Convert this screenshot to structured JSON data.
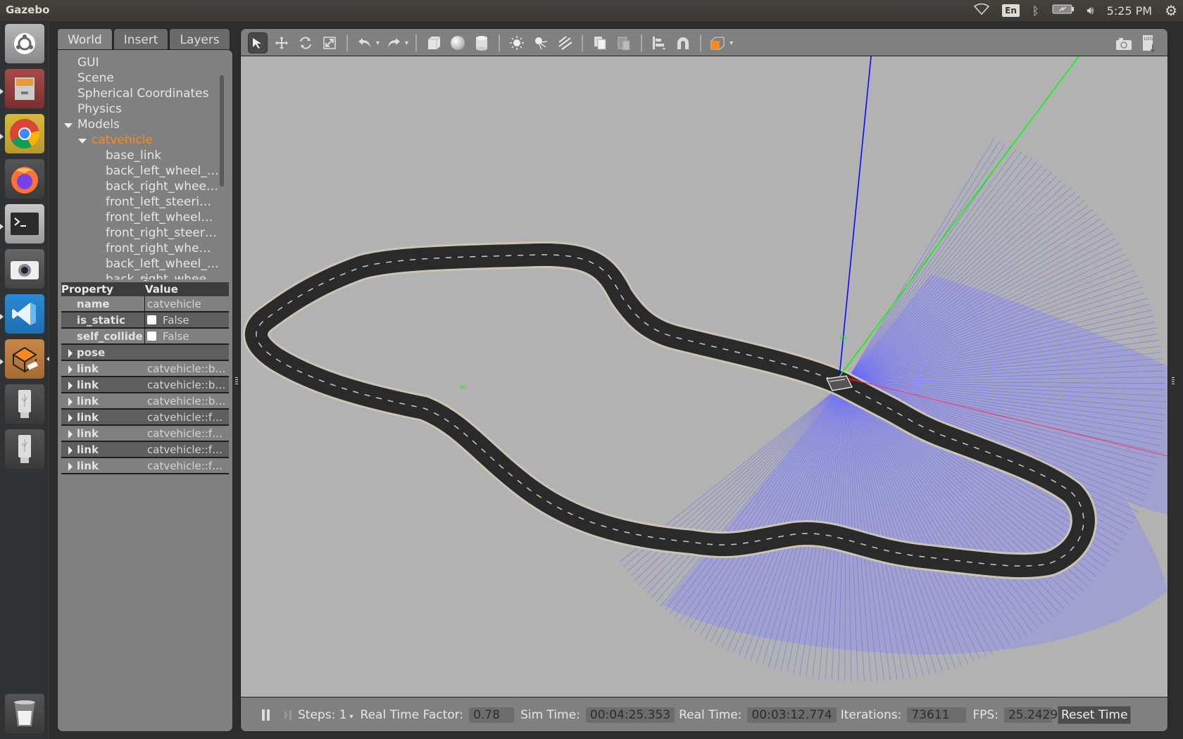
{
  "topbar": {
    "app_title": "Gazebo",
    "keyboard_layout": "En",
    "clock": "5:25 PM"
  },
  "launcher": {
    "items": [
      {
        "name": "ubuntu-dash",
        "running": false
      },
      {
        "name": "files",
        "running": true
      },
      {
        "name": "chrome",
        "running": true
      },
      {
        "name": "firefox",
        "running": false
      },
      {
        "name": "terminal",
        "running": true
      },
      {
        "name": "camera",
        "running": false
      },
      {
        "name": "vscode",
        "running": true
      },
      {
        "name": "gazebo",
        "running": true,
        "focused": true
      },
      {
        "name": "usb-drive-1",
        "running": false
      },
      {
        "name": "usb-drive-2",
        "running": false
      },
      {
        "name": "trash",
        "running": false
      }
    ]
  },
  "left_panel": {
    "tabs": [
      {
        "label": "World",
        "active": true
      },
      {
        "label": "Insert",
        "active": false
      },
      {
        "label": "Layers",
        "active": false
      }
    ],
    "tree": {
      "top_items": [
        "GUI",
        "Scene",
        "Spherical Coordinates",
        "Physics"
      ],
      "models_label": "Models",
      "selected_model": "catvehicle",
      "links": [
        "base_link",
        "back_left_wheel_…",
        "back_right_whee…",
        "front_left_steeri…",
        "front_left_wheel…",
        "front_right_steer…",
        "front_right_whe…",
        "back_left_wheel_…",
        "back_right_whee…"
      ]
    },
    "properties": {
      "header_property": "Property",
      "header_value": "Value",
      "rows": [
        {
          "key": "name",
          "value": "catvehicle",
          "checkbox": false
        },
        {
          "key": "is_static",
          "value": "False",
          "checkbox": true
        },
        {
          "key": "self_collide",
          "value": "False",
          "checkbox": true
        }
      ],
      "expandable": [
        {
          "key": "pose",
          "value": ""
        },
        {
          "key": "link",
          "value": "catvehicle::b…"
        },
        {
          "key": "link",
          "value": "catvehicle::b…"
        },
        {
          "key": "link",
          "value": "catvehicle::b…"
        },
        {
          "key": "link",
          "value": "catvehicle::f…"
        },
        {
          "key": "link",
          "value": "catvehicle::f…"
        },
        {
          "key": "link",
          "value": "catvehicle::f…"
        },
        {
          "key": "link",
          "value": "catvehicle::f…"
        }
      ]
    }
  },
  "toolbar": {
    "tools": [
      "select",
      "translate",
      "rotate",
      "scale",
      "undo",
      "redo",
      "box",
      "sphere",
      "cylinder",
      "point-light",
      "spot-light",
      "directional-light",
      "copy",
      "paste",
      "align",
      "snap",
      "view-angle"
    ],
    "right_tools": [
      "screenshot",
      "log"
    ]
  },
  "bottom_bar": {
    "steps_label": "Steps: 1",
    "rtf_label": "Real Time Factor:",
    "rtf_value": "0.78",
    "sim_time_label": "Sim Time:",
    "sim_time_value": "00:04:25.353",
    "real_time_label": "Real Time:",
    "real_time_value": "00:03:12.774",
    "iterations_label": "Iterations:",
    "iterations_value": "73611",
    "fps_label": "FPS:",
    "fps_value": "25.2429",
    "reset_label": "Reset Time"
  },
  "colors": {
    "selected_model": "#f58a1f",
    "laser_rays": "#6464ff",
    "axis_x": "#ff0000",
    "axis_y": "#00ff00",
    "axis_z": "#0000ff",
    "road": "#2a2a2a",
    "ground": "#b2b2b2"
  }
}
